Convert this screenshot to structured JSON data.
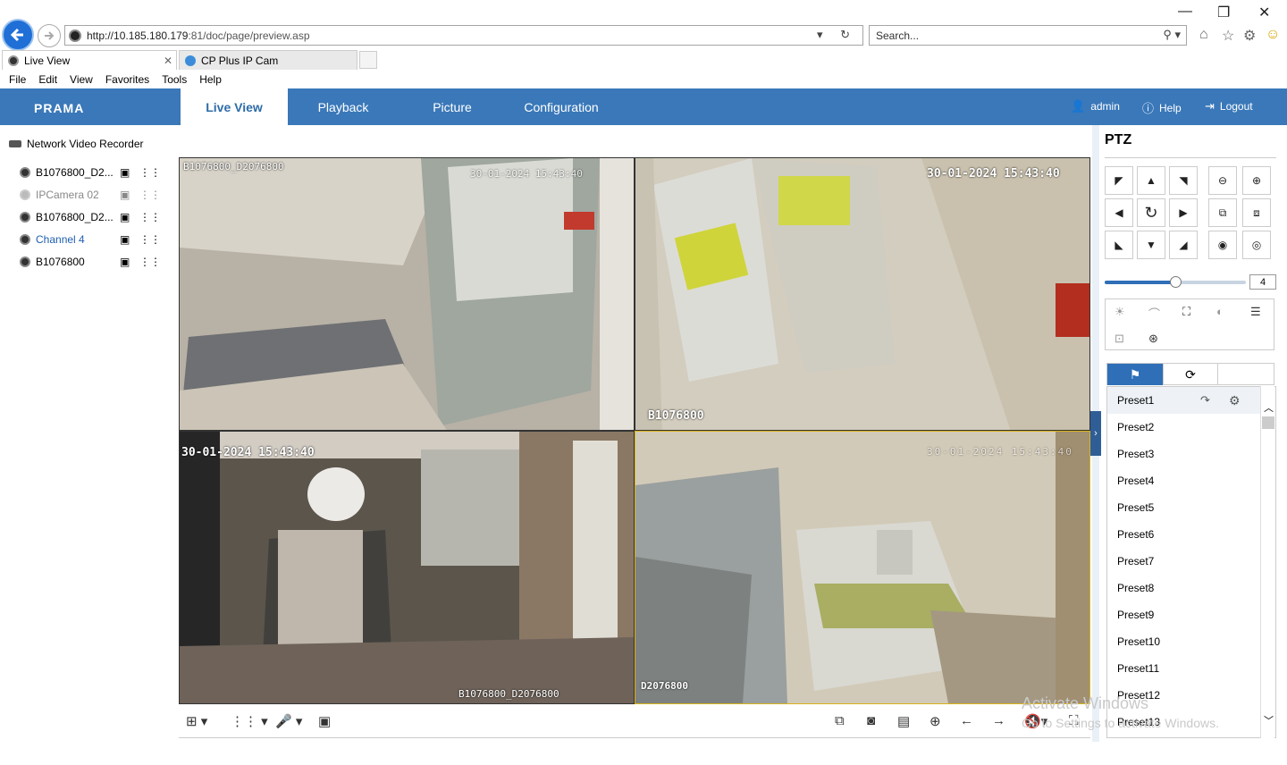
{
  "browser": {
    "address_host": "http://10.185.180.179",
    "address_port_path": ":81/doc/page/preview.asp",
    "search_placeholder": "Search...",
    "tabs": [
      {
        "label": "Live View"
      },
      {
        "label": "CP Plus IP Cam"
      }
    ],
    "menu": [
      "File",
      "Edit",
      "View",
      "Favorites",
      "Tools",
      "Help"
    ],
    "window_controls": {
      "minimize": "—",
      "restore": "❐",
      "close": "✕"
    }
  },
  "app": {
    "logo": "PRAMA",
    "nav_tabs": [
      "Live View",
      "Playback",
      "Picture",
      "Configuration"
    ],
    "active_tab": "Live View",
    "user": "admin",
    "help": "Help",
    "logout": "Logout",
    "brand_color": "#3a78b9"
  },
  "tree": {
    "root": "Network Video Recorder",
    "items": [
      {
        "label": "B1076800_D2...",
        "state": "online"
      },
      {
        "label": "IPCamera 02",
        "state": "offline"
      },
      {
        "label": "B1076800_D2...",
        "state": "online"
      },
      {
        "label": "Channel 4",
        "state": "selected"
      },
      {
        "label": "B1076800",
        "state": "online"
      }
    ]
  },
  "video": {
    "cells": [
      {
        "top_label": "B1076800_D2076800",
        "timestamp": "30-01-2024 15:43:40",
        "bottom_label": ""
      },
      {
        "top_label": "",
        "timestamp": "30-01-2024 15:43:40",
        "bottom_label": "B1076800"
      },
      {
        "top_label": "",
        "timestamp": "30-01-2024 15:43:40",
        "bottom_label": "B1076800_D2076800"
      },
      {
        "top_label": "",
        "timestamp": "30-01-2024 15:43:40",
        "bottom_label": "D2076800"
      }
    ],
    "selected_cell": 3
  },
  "ptz": {
    "title": "PTZ",
    "speed": "4",
    "speed_fraction": 0.5,
    "presets": [
      "Preset1",
      "Preset2",
      "Preset3",
      "Preset4",
      "Preset5",
      "Preset6",
      "Preset7",
      "Preset8",
      "Preset9",
      "Preset10",
      "Preset11",
      "Preset12",
      "Preset13"
    ]
  },
  "watermark": {
    "line1": "Activate Windows",
    "line2": "Go to Settings to activate Windows."
  }
}
